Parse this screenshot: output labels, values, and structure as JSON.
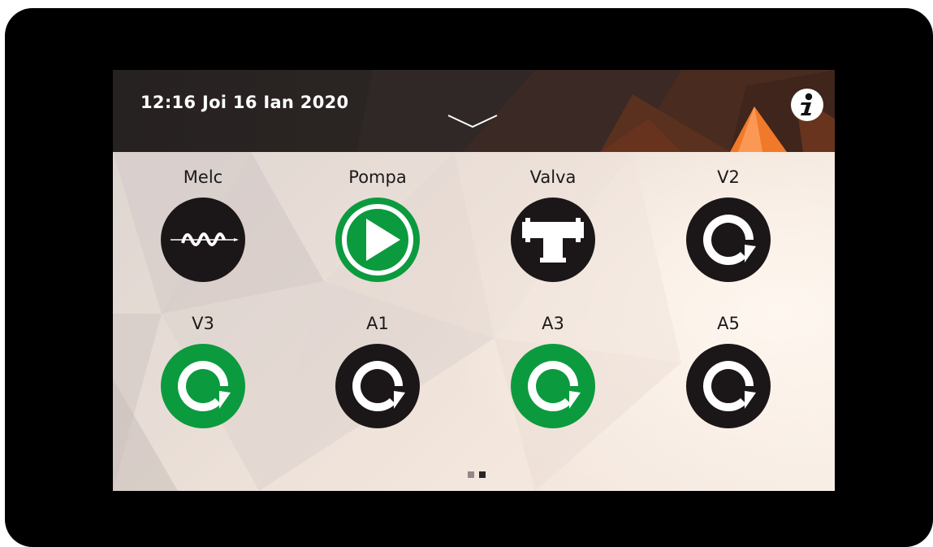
{
  "header": {
    "datetime": "12:16 Joi 16 Ian 2020",
    "expand_icon": "chevron-down-icon",
    "info_icon": "info-icon"
  },
  "tiles": [
    {
      "label": "Melc",
      "icon": "auger-icon",
      "state": "off"
    },
    {
      "label": "Pompa",
      "icon": "pump-icon",
      "state": "on"
    },
    {
      "label": "Valva",
      "icon": "valve-icon",
      "state": "off"
    },
    {
      "label": "V2",
      "icon": "fan-rotate-icon",
      "state": "off"
    },
    {
      "label": "V3",
      "icon": "fan-rotate-icon",
      "state": "on"
    },
    {
      "label": "A1",
      "icon": "fan-rotate-icon",
      "state": "off"
    },
    {
      "label": "A3",
      "icon": "fan-rotate-icon",
      "state": "on"
    },
    {
      "label": "A5",
      "icon": "fan-rotate-icon",
      "state": "off"
    }
  ],
  "pager": {
    "pages": 2,
    "current_page": 2
  },
  "colors": {
    "device_bezel": "#000000",
    "icon_on": "#0c9a3e",
    "icon_off": "#1b1718",
    "header_bg": "#262221",
    "accent_orange": "#f07a2a"
  }
}
